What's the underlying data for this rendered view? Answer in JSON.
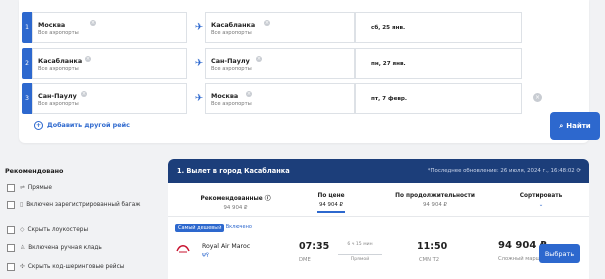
{
  "search": {
    "legs": [
      {
        "index": "1",
        "from": "Москва",
        "from_sub": "Все аэропорты",
        "to": "Касабланка",
        "to_sub": "Все аэропорты",
        "date": "сб, 25 янв."
      },
      {
        "index": "2",
        "from": "Касабланка",
        "from_sub": "Все аэропорты",
        "to": "Сан-Паулу",
        "to_sub": "Все аэропорты",
        "date": "пн, 27 янв."
      },
      {
        "index": "3",
        "from": "Сан-Паулу",
        "from_sub": "Все аэропорты",
        "to": "Москва",
        "to_sub": "Все аэропорты",
        "date": "пт, 7 февр."
      }
    ],
    "add_flight": "Добавить другой рейс",
    "find_button": "Найти"
  },
  "filters": {
    "title": "Рекомендовано",
    "items": [
      {
        "label": "Прямые",
        "icon": "direct-icon"
      },
      {
        "label": "Включен зарегистрированный багаж",
        "icon": "baggage-icon"
      },
      {
        "label": "Скрыть лоукостеры",
        "icon": "tag-icon"
      },
      {
        "label": "Включена ручная кладь",
        "icon": "handbag-icon"
      },
      {
        "label": "Скрыть код-шеринговые рейсы",
        "icon": "codeshare-icon"
      }
    ]
  },
  "results": {
    "title": "1. Вылет в город Касабланка",
    "updated": "*Последнее обновление: 26 июля, 2024 г., 16:48:02",
    "sort": [
      {
        "label": "Рекомендованные",
        "value": "94 904 ₽"
      },
      {
        "label": "По цене",
        "value": "94 904 ₽"
      },
      {
        "label": "По продолжительности",
        "value": "94 904 ₽"
      },
      {
        "label": "Сортировать",
        "value": ""
      }
    ],
    "badge_cheapest": "Самый дешевый",
    "badge_included": "Включено",
    "flight": {
      "airline": "Royal Air Maroc",
      "depart_time": "07:35",
      "depart_airport": "DME",
      "duration": "6 ч 15 мин",
      "stops": "Прямой",
      "arrive_time": "11:50",
      "arrive_airport": "CMN T2",
      "price": "94 904 ₽",
      "route_type": "Сложный маршрут",
      "choose": "Выбрать"
    }
  },
  "colors": {
    "accent": "#2d68ce",
    "header": "#1c3e7a"
  }
}
